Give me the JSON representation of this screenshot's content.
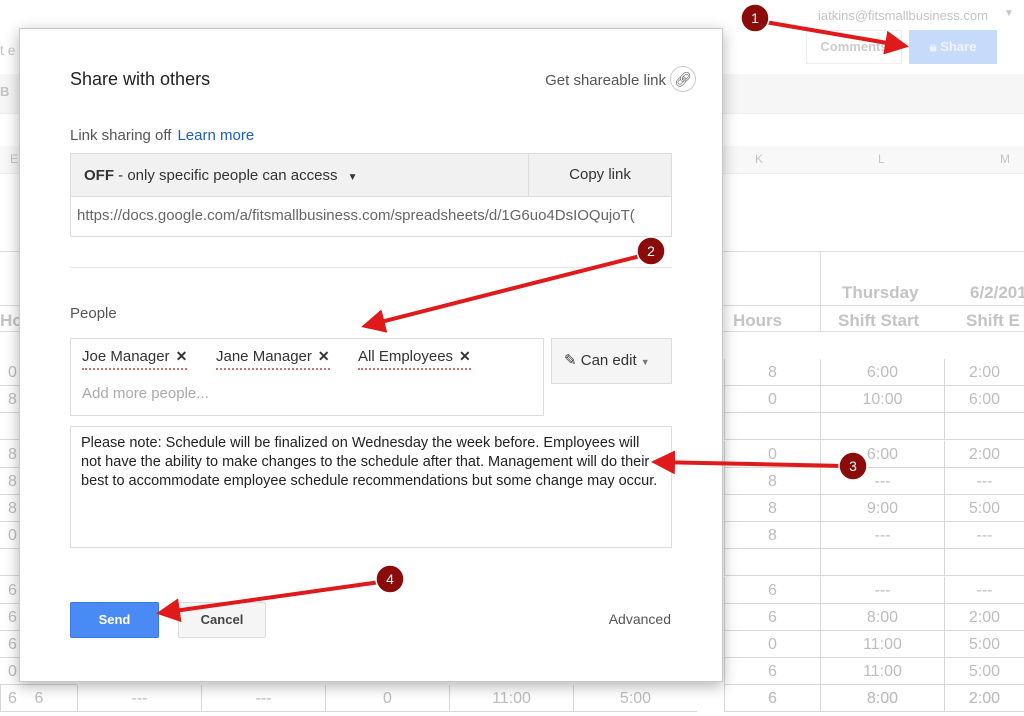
{
  "background": {
    "account": "iatkins@fitsmallbusiness.com",
    "comments_button": "Comments",
    "share_button": "Share",
    "toolbar_fragment": "t e",
    "bold_fragment": "B",
    "col_e": "E",
    "columns": [
      "K",
      "L",
      "M"
    ],
    "day": "Thursday",
    "date": "6/2/201",
    "headers": [
      "Hours",
      "Shift Start",
      "Shift E"
    ],
    "left_header": "Hou",
    "left_values": [
      "0",
      "8",
      "",
      "8",
      "8",
      "8",
      "0",
      "",
      "6",
      "6",
      "6",
      "0",
      "6"
    ],
    "rows": [
      [
        "8",
        "6:00",
        "2:00"
      ],
      [
        "0",
        "10:00",
        "6:00"
      ],
      [
        "",
        "",
        ""
      ],
      [
        "0",
        "6:00",
        "2:00"
      ],
      [
        "8",
        "---",
        "---"
      ],
      [
        "8",
        "9:00",
        "5:00"
      ],
      [
        "8",
        "---",
        "---"
      ],
      [
        "",
        "",
        ""
      ],
      [
        "6",
        "---",
        "---"
      ],
      [
        "6",
        "8:00",
        "2:00"
      ],
      [
        "0",
        "11:00",
        "5:00"
      ],
      [
        "6",
        "11:00",
        "5:00"
      ],
      [
        "6",
        "8:00",
        "2:00"
      ]
    ],
    "bottom_row": [
      "---",
      "---",
      "0",
      "11:00",
      "5:00"
    ]
  },
  "dialog": {
    "title": "Share with others",
    "get_link": "Get shareable link",
    "link_sharing": "Link sharing off",
    "learn_more": "Learn more",
    "off_bold": "OFF",
    "off_text": " - only specific people can access",
    "copy_link": "Copy link",
    "url": "https://docs.google.com/a/fitsmallbusiness.com/spreadsheets/d/1G6uo4DsIOQujoT(",
    "people_label": "People",
    "chips": [
      "Joe Manager",
      "Jane Manager",
      "All Employees"
    ],
    "add_placeholder": "Add more people...",
    "permission": "Can edit",
    "message": "Please note: Schedule will be finalized on Wednesday the week before. Employees will not have the ability to make changes to the schedule after that. Management will do their best to accommodate employee schedule recommendations but some change may occur.",
    "send": "Send",
    "cancel": "Cancel",
    "advanced": "Advanced"
  },
  "annotations": [
    "1",
    "2",
    "3",
    "4"
  ],
  "colors": {
    "primary": "#4a8af4",
    "annotation_arrow": "#e0191b",
    "annotation_badge": "#8b0a0a"
  }
}
